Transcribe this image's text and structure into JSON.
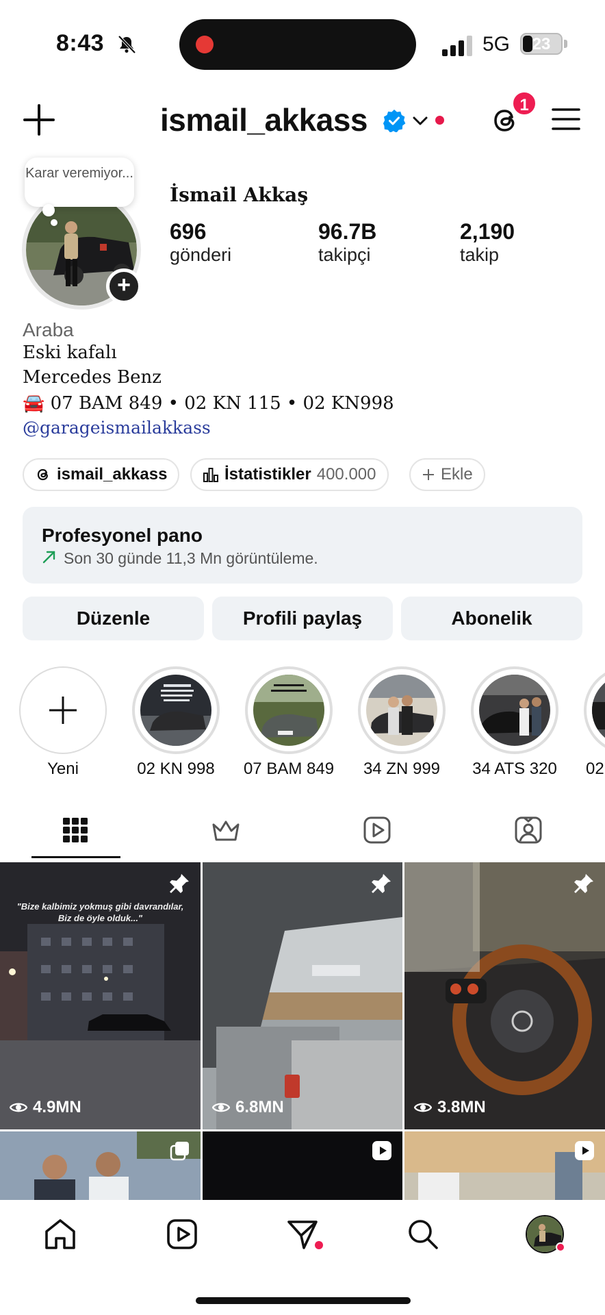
{
  "status_bar": {
    "time": "8:43",
    "network": "5G",
    "battery": "23"
  },
  "header": {
    "username": "ismail_akkass",
    "notification_count": "1"
  },
  "profile": {
    "note": "Karar veremiyor...",
    "full_name": "İsmail Akkaş",
    "stats": [
      {
        "value": "696",
        "label": "gönderi"
      },
      {
        "value": "96.7B",
        "label": "takipçi"
      },
      {
        "value": "2,190",
        "label": "takip"
      }
    ],
    "category": "Araba",
    "bio_lines": [
      "Eski kafalı",
      "Mercedes Benz",
      "🚘 07 BAM 849  • 02 KN 115 • 02 KN998"
    ],
    "link": "@garageismailakkass"
  },
  "chips": {
    "threads": "ismail_akkass",
    "insights_label": "İstatistikler",
    "insights_value": "400.000",
    "add": "Ekle"
  },
  "dashboard": {
    "title": "Profesyonel pano",
    "subtitle": "Son 30 günde 11,3 Mn görüntüleme."
  },
  "buttons": {
    "edit": "Düzenle",
    "share": "Profili paylaş",
    "subscription": "Abonelik"
  },
  "highlights": [
    {
      "label": "Yeni"
    },
    {
      "label": "02 KN 998"
    },
    {
      "label": "07 BAM 849"
    },
    {
      "label": "34 ZN 999"
    },
    {
      "label": "34 ATS 320"
    },
    {
      "label": "02"
    }
  ],
  "posts": [
    {
      "views": "4.9MN",
      "caption": "\"Bize kalbimiz yokmuş gibi davrandılar, Biz de öyle olduk...\""
    },
    {
      "views": "6.8MN"
    },
    {
      "views": "3.8MN"
    }
  ],
  "colors": {
    "accent_red": "#ee1d52",
    "verified_blue": "#0095f6",
    "link": "#2b3d9c",
    "panel_bg": "#eff2f5"
  }
}
